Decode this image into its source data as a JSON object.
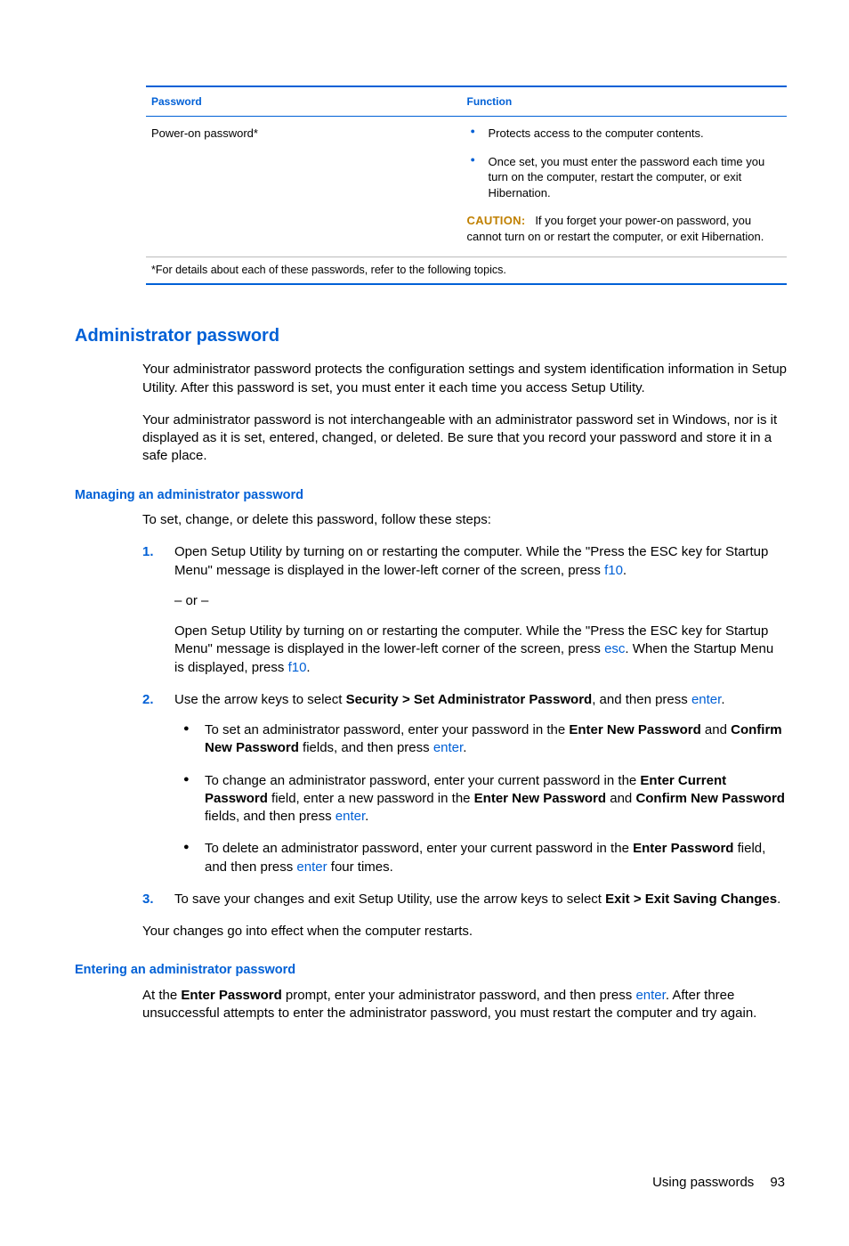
{
  "table": {
    "head_password": "Password",
    "head_function": "Function",
    "row_password": "Power-on password*",
    "func_item1": "Protects access to the computer contents.",
    "func_item2": "Once set, you must enter the password each time you turn on the computer, restart the computer, or exit Hibernation.",
    "caution_label": "CAUTION:",
    "caution_text": "If you forget your power-on password, you cannot turn on or restart the computer, or exit Hibernation.",
    "footnote": "*For details about each of these passwords, refer to the following topics."
  },
  "section": {
    "heading": "Administrator password",
    "para1": "Your administrator password protects the configuration settings and system identification information in Setup Utility. After this password is set, you must enter it each time you access Setup Utility.",
    "para2": "Your administrator password is not interchangeable with an administrator password set in Windows, nor is it displayed as it is set, entered, changed, or deleted. Be sure that you record your password and store it in a safe place.",
    "sub1_heading": "Managing an administrator password",
    "sub1_intro": "To set, change, or delete this password, follow these steps:",
    "step1_a": "Open Setup Utility by turning on or restarting the computer. While the \"Press the ESC key for Startup Menu\" message is displayed in the lower-left corner of the screen, press ",
    "key_f10": "f10",
    "step1_b": ".",
    "step1_or": "– or –",
    "step1_c": "Open Setup Utility by turning on or restarting the computer. While the \"Press the ESC key for Startup Menu\" message is displayed in the lower-left corner of the screen, press ",
    "key_esc": "esc",
    "step1_d": ". When the Startup Menu is displayed, press ",
    "step1_e": ".",
    "step2_a": "Use the arrow keys to select ",
    "step2_bold": "Security > Set Administrator Password",
    "step2_b": ", and then press ",
    "key_enter": "enter",
    "step2_c": ".",
    "bullet1_a": "To set an administrator password, enter your password in the ",
    "bullet1_bold1": "Enter New Password",
    "bullet1_b": " and ",
    "bullet1_bold2": "Confirm New Password",
    "bullet1_c": " fields, and then press ",
    "bullet1_d": ".",
    "bullet2_a": "To change an administrator password, enter your current password in the ",
    "bullet2_bold1": "Enter Current Password",
    "bullet2_b": " field, enter a new password in the ",
    "bullet2_bold2": "Enter New Password",
    "bullet2_c": " and ",
    "bullet2_bold3": "Confirm New Password",
    "bullet2_d": " fields, and then press ",
    "bullet2_e": ".",
    "bullet3_a": "To delete an administrator password, enter your current password in the ",
    "bullet3_bold1": "Enter Password",
    "bullet3_b": " field, and then press ",
    "bullet3_c": " four times.",
    "step3_a": "To save your changes and exit Setup Utility, use the arrow keys to select ",
    "step3_bold": "Exit > Exit Saving Changes",
    "step3_b": ".",
    "after_steps": "Your changes go into effect when the computer restarts.",
    "sub2_heading": "Entering an administrator password",
    "enter_a": "At the ",
    "enter_bold": "Enter Password",
    "enter_b": " prompt, enter your administrator password, and then press ",
    "enter_c": ". After three unsuccessful attempts to enter the administrator password, you must restart the computer and try again."
  },
  "footer": {
    "label": "Using passwords",
    "page": "93"
  }
}
